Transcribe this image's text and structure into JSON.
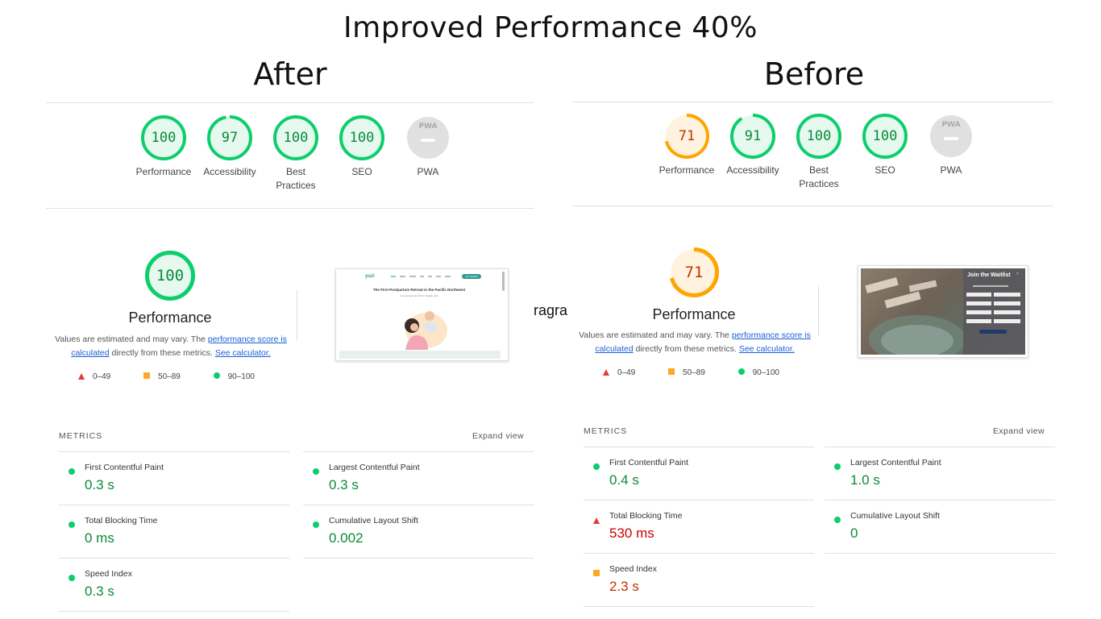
{
  "page": {
    "title": "Improved Performance 40%",
    "stray_text": "ragra"
  },
  "after": {
    "heading": "After",
    "scores": [
      {
        "label": "Performance",
        "value": "100",
        "score": 100,
        "color": "#0cce6b",
        "text_color": "#0a8a3a"
      },
      {
        "label": "Accessibility",
        "value": "97",
        "score": 97,
        "color": "#0cce6b",
        "text_color": "#0a8a3a"
      },
      {
        "label": "Best Practices",
        "value": "100",
        "score": 100,
        "color": "#0cce6b",
        "text_color": "#0a8a3a"
      },
      {
        "label": "SEO",
        "value": "100",
        "score": 100,
        "color": "#0cce6b",
        "text_color": "#0a8a3a"
      },
      {
        "label": "PWA",
        "value": "PWA",
        "score": 0,
        "color": "#dddddd",
        "text_color": "#aaaaaa"
      }
    ],
    "perf_score": "100",
    "perf_score_num": 100,
    "perf_title": "Performance",
    "desc_1": "Values are estimated and may vary. The ",
    "desc_link1": "performance score is calculated",
    "desc_2": " directly from these metrics. ",
    "desc_link2": "See calculator.",
    "legend": [
      "0–49",
      "50–89",
      "90–100"
    ],
    "screenshot": {
      "brand": "yuzi",
      "headline": "The First Postpartum Retreat in the Pacific Northwest",
      "sub": "Coming Spring 2024 in Seattle, WA",
      "cta": "Join Waitlist"
    },
    "metrics_heading": "METRICS",
    "expand": "Expand view",
    "metrics": [
      {
        "name": "First Contentful Paint",
        "value": "0.3 s",
        "status": "good"
      },
      {
        "name": "Largest Contentful Paint",
        "value": "0.3 s",
        "status": "good"
      },
      {
        "name": "Total Blocking Time",
        "value": "0 ms",
        "status": "good"
      },
      {
        "name": "Cumulative Layout Shift",
        "value": "0.002",
        "status": "good"
      },
      {
        "name": "Speed Index",
        "value": "0.3 s",
        "status": "good"
      }
    ]
  },
  "before": {
    "heading": "Before",
    "scores": [
      {
        "label": "Performance",
        "value": "71",
        "score": 71,
        "color": "#ffa400",
        "text_color": "#c33300"
      },
      {
        "label": "Accessibility",
        "value": "91",
        "score": 91,
        "color": "#0cce6b",
        "text_color": "#0a8a3a"
      },
      {
        "label": "Best Practices",
        "value": "100",
        "score": 100,
        "color": "#0cce6b",
        "text_color": "#0a8a3a"
      },
      {
        "label": "SEO",
        "value": "100",
        "score": 100,
        "color": "#0cce6b",
        "text_color": "#0a8a3a"
      },
      {
        "label": "PWA",
        "value": "PWA",
        "score": 0,
        "color": "#dddddd",
        "text_color": "#aaaaaa"
      }
    ],
    "perf_score": "71",
    "perf_score_num": 71,
    "perf_title": "Performance",
    "desc_1": "Values are estimated and may vary. The ",
    "desc_link1": "performance score is calculated",
    "desc_2": " directly from these metrics. ",
    "desc_link2": "See calculator.",
    "legend": [
      "0–49",
      "50–89",
      "90–100"
    ],
    "screenshot": {
      "modal_title": "Join the Waitlist"
    },
    "metrics_heading": "METRICS",
    "expand": "Expand view",
    "metrics": [
      {
        "name": "First Contentful Paint",
        "value": "0.4 s",
        "status": "good"
      },
      {
        "name": "Largest Contentful Paint",
        "value": "1.0 s",
        "status": "good"
      },
      {
        "name": "Total Blocking Time",
        "value": "530 ms",
        "status": "poor"
      },
      {
        "name": "Cumulative Layout Shift",
        "value": "0",
        "status": "good"
      },
      {
        "name": "Speed Index",
        "value": "2.3 s",
        "status": "average"
      }
    ]
  }
}
